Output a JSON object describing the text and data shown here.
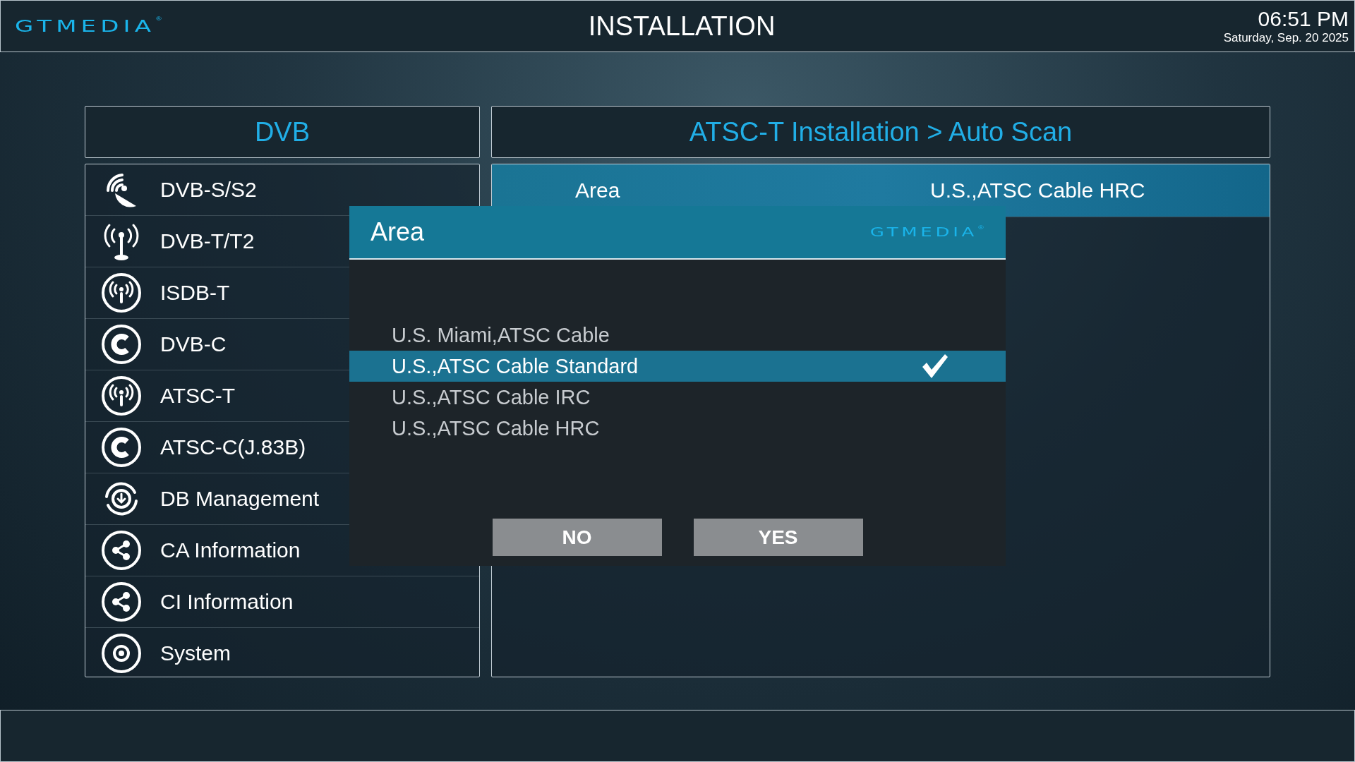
{
  "header": {
    "logo": "GTMEDIA",
    "logo_mark": "®",
    "title": "INSTALLATION",
    "time": "06:51 PM",
    "date": "Saturday, Sep. 20 2025"
  },
  "menu": {
    "title": "DVB",
    "items": [
      {
        "label": "DVB-S/S2"
      },
      {
        "label": "DVB-T/T2"
      },
      {
        "label": "ISDB-T"
      },
      {
        "label": "DVB-C"
      },
      {
        "label": "ATSC-T"
      },
      {
        "label": "ATSC-C(J.83B)"
      },
      {
        "label": "DB Management"
      },
      {
        "label": "CA Information"
      },
      {
        "label": "CI Information"
      },
      {
        "label": "System"
      }
    ]
  },
  "panel": {
    "title": "ATSC-T Installation > Auto Scan",
    "rows": [
      {
        "label": "Area",
        "value": "U.S.,ATSC Cable HRC",
        "selected": true
      }
    ]
  },
  "dialog": {
    "title": "Area",
    "logo": "GTMEDIA",
    "logo_mark": "®",
    "options": [
      {
        "label": "U.S. Miami,ATSC Cable",
        "selected": false
      },
      {
        "label": "U.S.,ATSC Cable Standard",
        "selected": true
      },
      {
        "label": "U.S.,ATSC Cable IRC",
        "selected": false
      },
      {
        "label": "U.S.,ATSC Cable HRC",
        "selected": false
      }
    ],
    "buttons": [
      "NO",
      "YES"
    ]
  }
}
